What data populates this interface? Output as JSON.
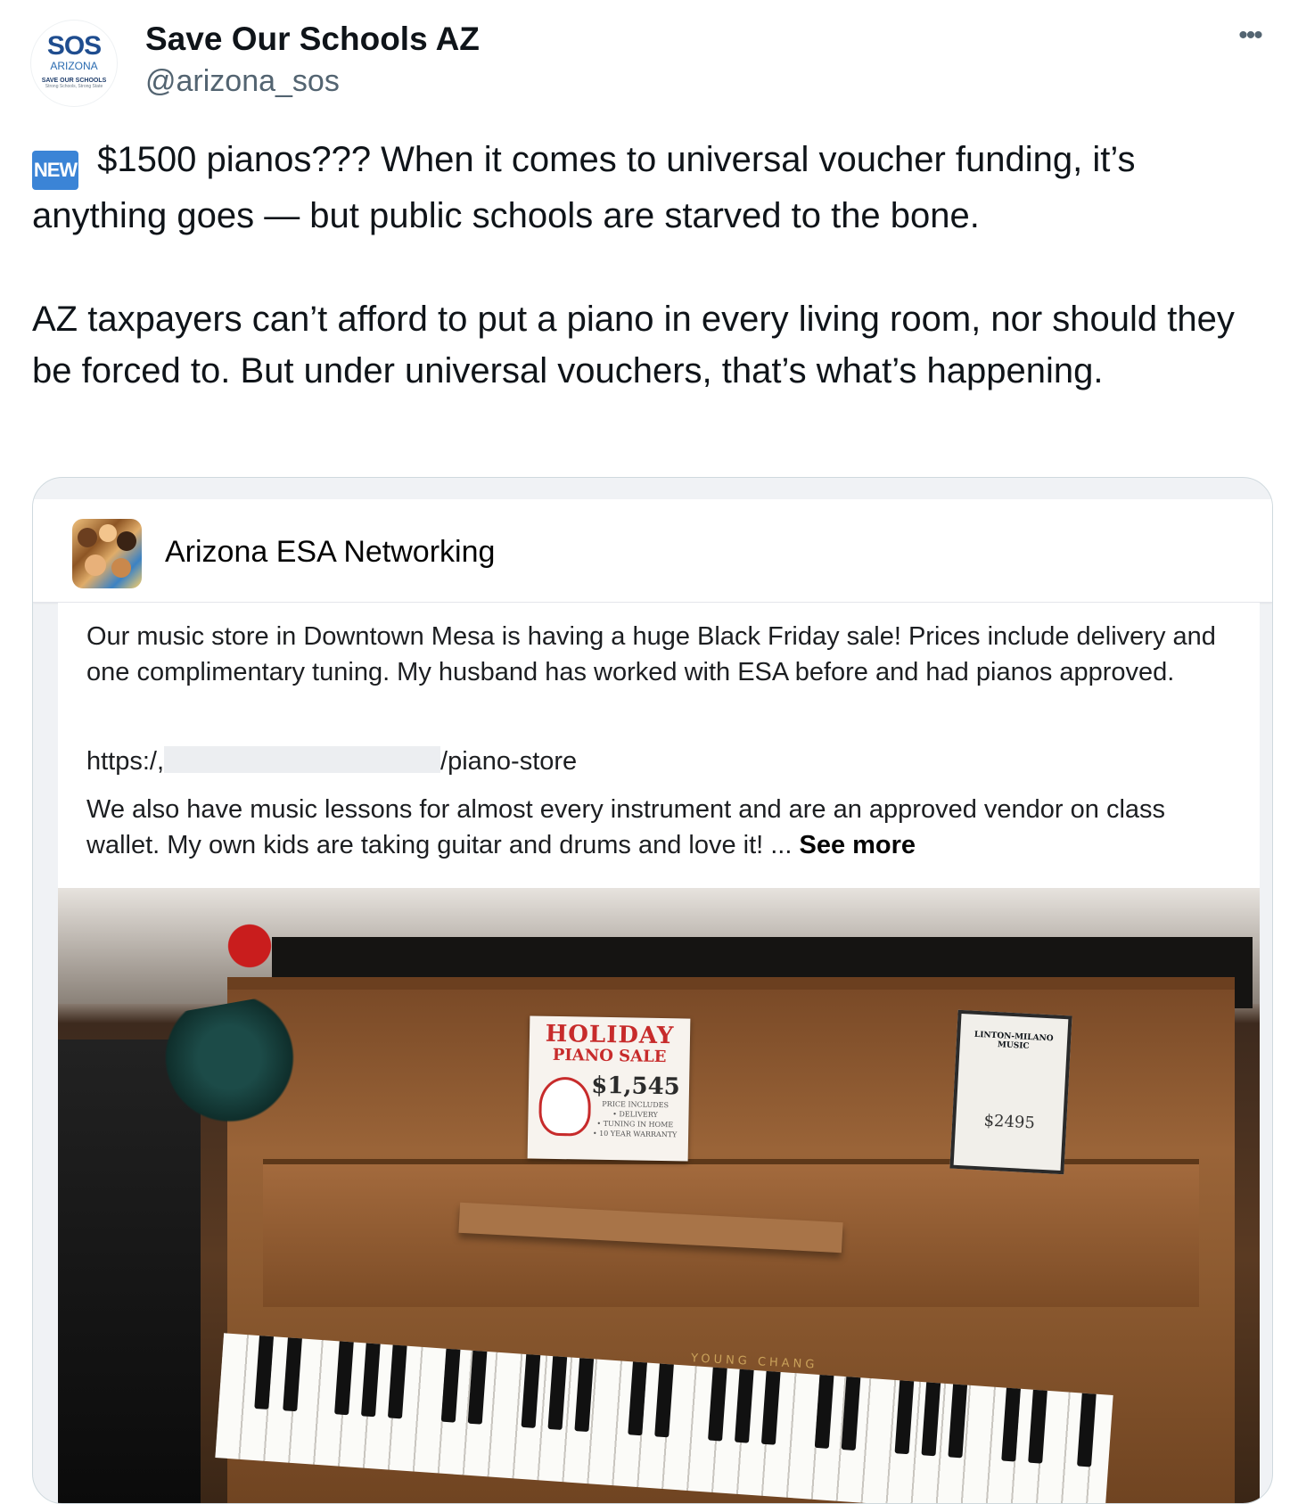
{
  "tweet": {
    "author": {
      "name": "Save Our Schools AZ",
      "handle": "@arizona_sos",
      "avatar": {
        "mark": "SOS",
        "state": "ARIZONA",
        "tagline": "SAVE OUR SCHOOLS",
        "subline": "Strong Schools, Strong State"
      }
    },
    "more_label": "•••",
    "badge": "NEW",
    "text": " $1500 pianos??? When it comes to universal voucher funding, it’s anything goes — but public schools are starved to the bone.\n\nAZ taxpayers can’t afford to put a piano in every living room, nor should they be forced to. But under universal vouchers, that’s what’s happening."
  },
  "embedded_post": {
    "group_name": "Arizona ESA Networking",
    "paragraph1": "Our music store in Downtown Mesa is having a huge Black Friday sale! Prices include delivery and one complimentary tuning. My husband has worked with ESA before and had pianos approved.",
    "link_prefix": "https:/,",
    "link_suffix": "/piano-store",
    "paragraph2": "We also have music lessons for almost every instrument and are an approved vendor on class wallet. My own kids are taking guitar and drums and love it! ... ",
    "see_more": "See more",
    "photo": {
      "sign_line1": "HOLIDAY",
      "sign_line2": "PIANO SALE",
      "sign_price": "$1,545",
      "sign_details": [
        "PRICE INCLUDES",
        "• DELIVERY",
        "• TUNING IN HOME",
        "• 10 YEAR WARRANTY"
      ],
      "tag_brand": "LINTON-MILANO MUSIC",
      "tag_price": "$2495",
      "piano_brand": "YOUNG CHANG"
    }
  }
}
